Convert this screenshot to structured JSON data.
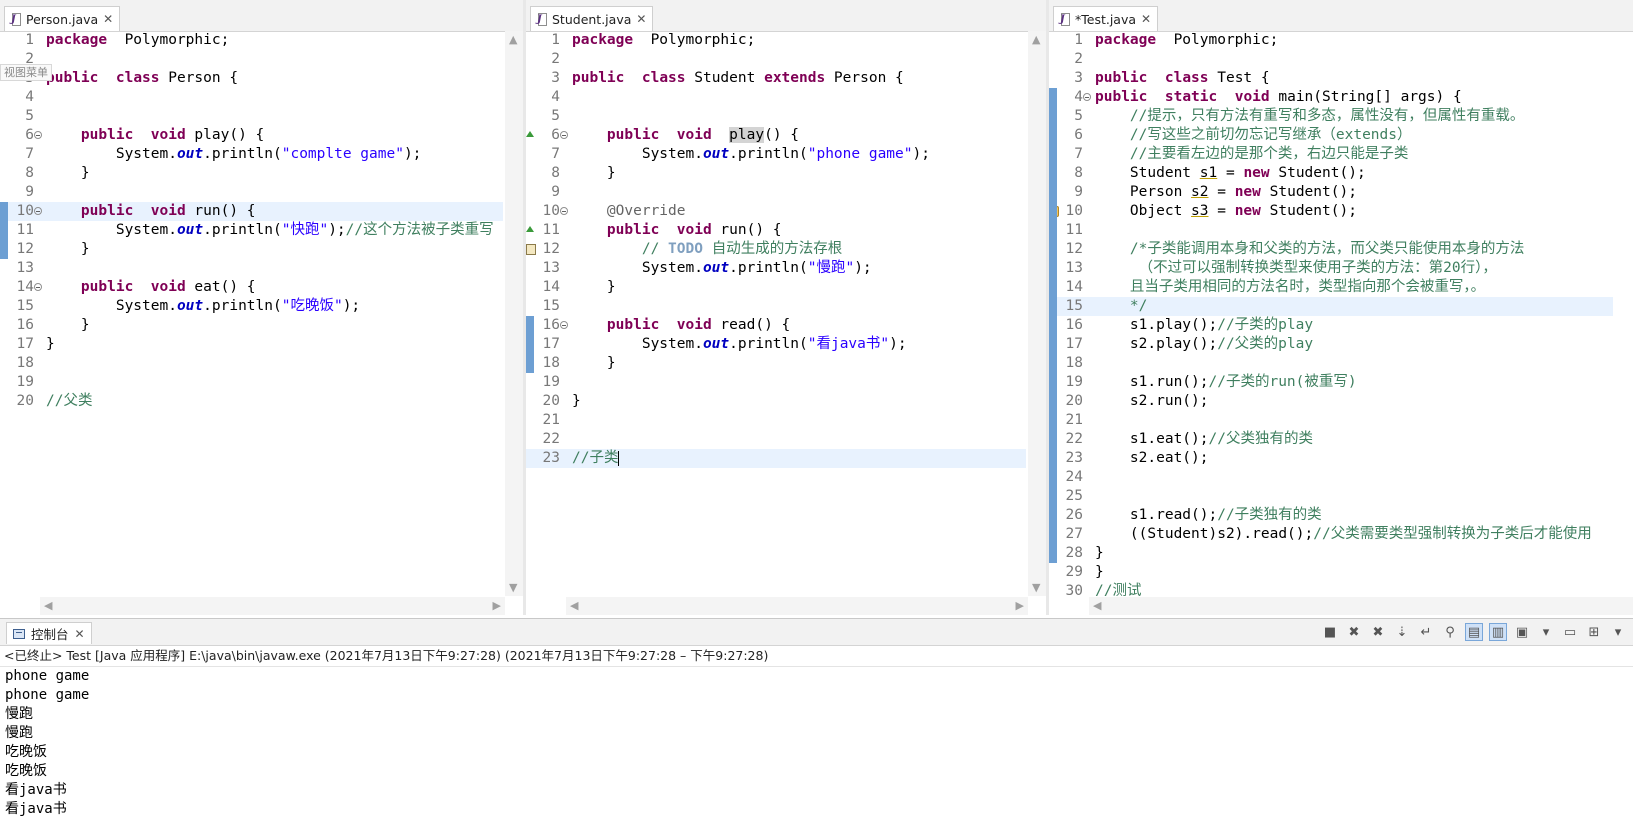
{
  "editors": [
    {
      "tab": "Person.java",
      "tooltip": "视图菜单",
      "lines": [
        {
          "n": "1",
          "t": [
            [
              "kw",
              "package"
            ],
            [
              "",
              "  Polymorphic;"
            ]
          ]
        },
        {
          "n": "2",
          "t": []
        },
        {
          "n": "3",
          "t": [
            [
              "kw",
              "public"
            ],
            [
              "",
              ""
            ],
            [
              "kw",
              "class"
            ],
            [
              "",
              " Person {"
            ]
          ]
        },
        {
          "n": "4",
          "t": []
        },
        {
          "n": "5",
          "t": []
        },
        {
          "n": "6",
          "fold": true,
          "t": [
            [
              "",
              "    "
            ],
            [
              "kw",
              "public"
            ],
            [
              "",
              ""
            ],
            [
              "kw",
              "void"
            ],
            [
              "",
              " play() {"
            ]
          ]
        },
        {
          "n": "7",
          "t": [
            [
              "",
              "        System."
            ],
            [
              "fld",
              "out"
            ],
            [
              "",
              ".println("
            ],
            [
              "str",
              "\"complte game\""
            ],
            [
              "",
              ");"
            ]
          ]
        },
        {
          "n": "8",
          "t": [
            [
              "",
              "    }"
            ]
          ]
        },
        {
          "n": "9",
          "t": []
        },
        {
          "n": "10",
          "fold": true,
          "hl": true,
          "t": [
            [
              "",
              "    "
            ],
            [
              "kw",
              "public"
            ],
            [
              "",
              ""
            ],
            [
              "kw",
              "void"
            ],
            [
              "",
              " run() {"
            ]
          ]
        },
        {
          "n": "11",
          "t": [
            [
              "",
              "        System."
            ],
            [
              "fld",
              "out"
            ],
            [
              "",
              ".println("
            ],
            [
              "str",
              "\"快跑\""
            ],
            [
              "",
              ");"
            ],
            [
              "cm",
              "//这个方法被子类重写"
            ]
          ]
        },
        {
          "n": "12",
          "t": [
            [
              "",
              "    }"
            ]
          ]
        },
        {
          "n": "13",
          "t": []
        },
        {
          "n": "14",
          "fold": true,
          "t": [
            [
              "",
              "    "
            ],
            [
              "kw",
              "public"
            ],
            [
              "",
              ""
            ],
            [
              "kw",
              "void"
            ],
            [
              "",
              " eat() {"
            ]
          ]
        },
        {
          "n": "15",
          "t": [
            [
              "",
              "        System."
            ],
            [
              "fld",
              "out"
            ],
            [
              "",
              ".println("
            ],
            [
              "str",
              "\"吃晚饭\""
            ],
            [
              "",
              ");"
            ]
          ]
        },
        {
          "n": "16",
          "t": [
            [
              "",
              "    }"
            ]
          ]
        },
        {
          "n": "17",
          "t": [
            [
              "",
              "}"
            ]
          ]
        },
        {
          "n": "18",
          "t": []
        },
        {
          "n": "19",
          "t": []
        },
        {
          "n": "20",
          "t": [
            [
              "cm",
              "//父类"
            ]
          ]
        }
      ]
    },
    {
      "tab": "Student.java",
      "lines": [
        {
          "n": "1",
          "t": [
            [
              "kw",
              "package"
            ],
            [
              "",
              "  Polymorphic;"
            ]
          ]
        },
        {
          "n": "2",
          "t": []
        },
        {
          "n": "3",
          "t": [
            [
              "kw",
              "public"
            ],
            [
              "",
              ""
            ],
            [
              "kw",
              "class"
            ],
            [
              "",
              " Student "
            ],
            [
              "kw",
              "extends"
            ],
            [
              "",
              " Person {"
            ]
          ]
        },
        {
          "n": "4",
          "t": []
        },
        {
          "n": "5",
          "t": []
        },
        {
          "n": "6",
          "fold": true,
          "marker": "override",
          "t": [
            [
              "",
              "    "
            ],
            [
              "kw",
              "public"
            ],
            [
              "",
              ""
            ],
            [
              "kw",
              "void"
            ],
            [
              "",
              ""
            ],
            [
              "mark",
              "play"
            ],
            [
              "",
              "() {"
            ]
          ]
        },
        {
          "n": "7",
          "t": [
            [
              "",
              "        System."
            ],
            [
              "fld",
              "out"
            ],
            [
              "",
              ".println("
            ],
            [
              "str",
              "\"phone game\""
            ],
            [
              "",
              ");"
            ]
          ]
        },
        {
          "n": "8",
          "t": [
            [
              "",
              "    }"
            ]
          ]
        },
        {
          "n": "9",
          "t": []
        },
        {
          "n": "10",
          "fold": true,
          "t": [
            [
              "",
              "    "
            ],
            [
              "ann",
              "@Override"
            ]
          ]
        },
        {
          "n": "11",
          "marker": "override",
          "t": [
            [
              "",
              "    "
            ],
            [
              "kw",
              "public"
            ],
            [
              "",
              ""
            ],
            [
              "kw",
              "void"
            ],
            [
              "",
              " run() {"
            ]
          ]
        },
        {
          "n": "12",
          "marker": "todo",
          "t": [
            [
              "",
              "        "
            ],
            [
              "cm",
              "// "
            ],
            [
              "todo",
              "TODO"
            ],
            [
              "cm",
              " 自动生成的方法存根"
            ]
          ]
        },
        {
          "n": "13",
          "t": [
            [
              "",
              "        System."
            ],
            [
              "fld",
              "out"
            ],
            [
              "",
              ".println("
            ],
            [
              "str",
              "\"慢跑\""
            ],
            [
              "",
              ");"
            ]
          ]
        },
        {
          "n": "14",
          "t": [
            [
              "",
              "    }"
            ]
          ]
        },
        {
          "n": "15",
          "t": []
        },
        {
          "n": "16",
          "fold": true,
          "t": [
            [
              "",
              "    "
            ],
            [
              "kw",
              "public"
            ],
            [
              "",
              ""
            ],
            [
              "kw",
              "void"
            ],
            [
              "",
              " read() {"
            ]
          ]
        },
        {
          "n": "17",
          "t": [
            [
              "",
              "        System."
            ],
            [
              "fld",
              "out"
            ],
            [
              "",
              ".println("
            ],
            [
              "str",
              "\"看java书\""
            ],
            [
              "",
              ");"
            ]
          ]
        },
        {
          "n": "18",
          "t": [
            [
              "",
              "    }"
            ]
          ]
        },
        {
          "n": "19",
          "t": []
        },
        {
          "n": "20",
          "t": [
            [
              "",
              "}"
            ]
          ]
        },
        {
          "n": "21",
          "t": []
        },
        {
          "n": "22",
          "t": []
        },
        {
          "n": "23",
          "hl": true,
          "caret": true,
          "t": [
            [
              "cm",
              "//子类"
            ]
          ]
        }
      ]
    },
    {
      "tab": "*Test.java",
      "lines": [
        {
          "n": "1",
          "t": [
            [
              "kw",
              "package"
            ],
            [
              "",
              "  Polymorphic;"
            ]
          ]
        },
        {
          "n": "2",
          "t": []
        },
        {
          "n": "3",
          "t": [
            [
              "kw",
              "public"
            ],
            [
              "",
              ""
            ],
            [
              "kw",
              "class"
            ],
            [
              "",
              " Test {"
            ]
          ]
        },
        {
          "n": "4",
          "fold": true,
          "t": [
            [
              "kw",
              "public"
            ],
            [
              "",
              ""
            ],
            [
              "kw",
              "static"
            ],
            [
              "",
              ""
            ],
            [
              "kw",
              "void"
            ],
            [
              "",
              " main(String[] args) {"
            ]
          ]
        },
        {
          "n": "5",
          "t": [
            [
              "",
              "    "
            ],
            [
              "cm",
              "//提示，只有方法有重写和多态，属性没有，但属性有重载。"
            ]
          ]
        },
        {
          "n": "6",
          "t": [
            [
              "",
              "    "
            ],
            [
              "cm",
              "//写这些之前切勿忘记写继承（extends）"
            ]
          ]
        },
        {
          "n": "7",
          "t": [
            [
              "",
              "    "
            ],
            [
              "cm",
              "//主要看左边的是那个类，右边只能是子类"
            ]
          ]
        },
        {
          "n": "8",
          "t": [
            [
              "",
              "    Student "
            ],
            [
              "var",
              "s1"
            ],
            [
              "",
              " = "
            ],
            [
              "kw",
              "new"
            ],
            [
              "",
              " Student();"
            ]
          ]
        },
        {
          "n": "9",
          "t": [
            [
              "",
              "    Person "
            ],
            [
              "var",
              "s2"
            ],
            [
              "",
              " = "
            ],
            [
              "kw",
              "new"
            ],
            [
              "",
              " Student();"
            ]
          ]
        },
        {
          "n": "10",
          "marker": "warn",
          "t": [
            [
              "",
              "    Object "
            ],
            [
              "var",
              "s3"
            ],
            [
              "",
              " = "
            ],
            [
              "kw",
              "new"
            ],
            [
              "",
              " Student();"
            ]
          ]
        },
        {
          "n": "11",
          "t": []
        },
        {
          "n": "12",
          "t": [
            [
              "",
              "    "
            ],
            [
              "cm",
              "/*子类能调用本身和父类的方法，而父类只能使用本身的方法"
            ]
          ]
        },
        {
          "n": "13",
          "t": [
            [
              "",
              "     "
            ],
            [
              "cm",
              "（不过可以强制转换类型来使用子类的方法：第20行），"
            ]
          ]
        },
        {
          "n": "14",
          "t": [
            [
              "",
              "    "
            ],
            [
              "cm",
              "且当子类用相同的方法名时，类型指向那个会被重写，。"
            ]
          ]
        },
        {
          "n": "15",
          "hl": true,
          "t": [
            [
              "",
              "    "
            ],
            [
              "cm",
              "*/"
            ]
          ]
        },
        {
          "n": "16",
          "t": [
            [
              "",
              "    s1.play();"
            ],
            [
              "cm",
              "//子类的play"
            ]
          ]
        },
        {
          "n": "17",
          "t": [
            [
              "",
              "    s2.play();"
            ],
            [
              "cm",
              "//父类的play"
            ]
          ]
        },
        {
          "n": "18",
          "t": []
        },
        {
          "n": "19",
          "t": [
            [
              "",
              "    s1.run();"
            ],
            [
              "cm",
              "//子类的run(被重写)"
            ]
          ]
        },
        {
          "n": "20",
          "t": [
            [
              "",
              "    s2.run();"
            ]
          ]
        },
        {
          "n": "21",
          "t": []
        },
        {
          "n": "22",
          "t": [
            [
              "",
              "    s1.eat();"
            ],
            [
              "cm",
              "//父类独有的类"
            ]
          ]
        },
        {
          "n": "23",
          "t": [
            [
              "",
              "    s2.eat();"
            ]
          ]
        },
        {
          "n": "24",
          "t": []
        },
        {
          "n": "25",
          "t": []
        },
        {
          "n": "26",
          "t": [
            [
              "",
              "    s1.read();"
            ],
            [
              "cm",
              "//子类独有的类"
            ]
          ]
        },
        {
          "n": "27",
          "t": [
            [
              "",
              "    ((Student)s2).read();"
            ],
            [
              "cm",
              "//父类需要类型强制转换为子类后才能使用"
            ]
          ]
        },
        {
          "n": "28",
          "t": [
            [
              "",
              "}"
            ]
          ]
        },
        {
          "n": "29",
          "t": [
            [
              "",
              "}"
            ]
          ]
        },
        {
          "n": "30",
          "t": [
            [
              "cm",
              "//测试"
            ]
          ]
        }
      ]
    }
  ],
  "console": {
    "tab": "控制台",
    "status": "<已终止> Test [Java 应用程序] E:\\java\\bin\\javaw.exe  (2021年7月13日下午9:27:28)   (2021年7月13日下午9:27:28 – 下午9:27:28)",
    "output": [
      "phone game",
      "phone game",
      "慢跑",
      "慢跑",
      "吃晚饭",
      "吃晚饭",
      "看java书",
      "看java书"
    ],
    "toolbar": [
      "stop-icon",
      "remove-launch-icon",
      "remove-all-icon",
      "scroll-lock-icon",
      "word-wrap-icon",
      "pin-icon",
      "show-stdout-icon",
      "show-stderr-icon",
      "open-console-icon",
      "display-selected-icon",
      "view-menu-icon",
      "new-console-icon",
      "minimize-icon"
    ]
  }
}
